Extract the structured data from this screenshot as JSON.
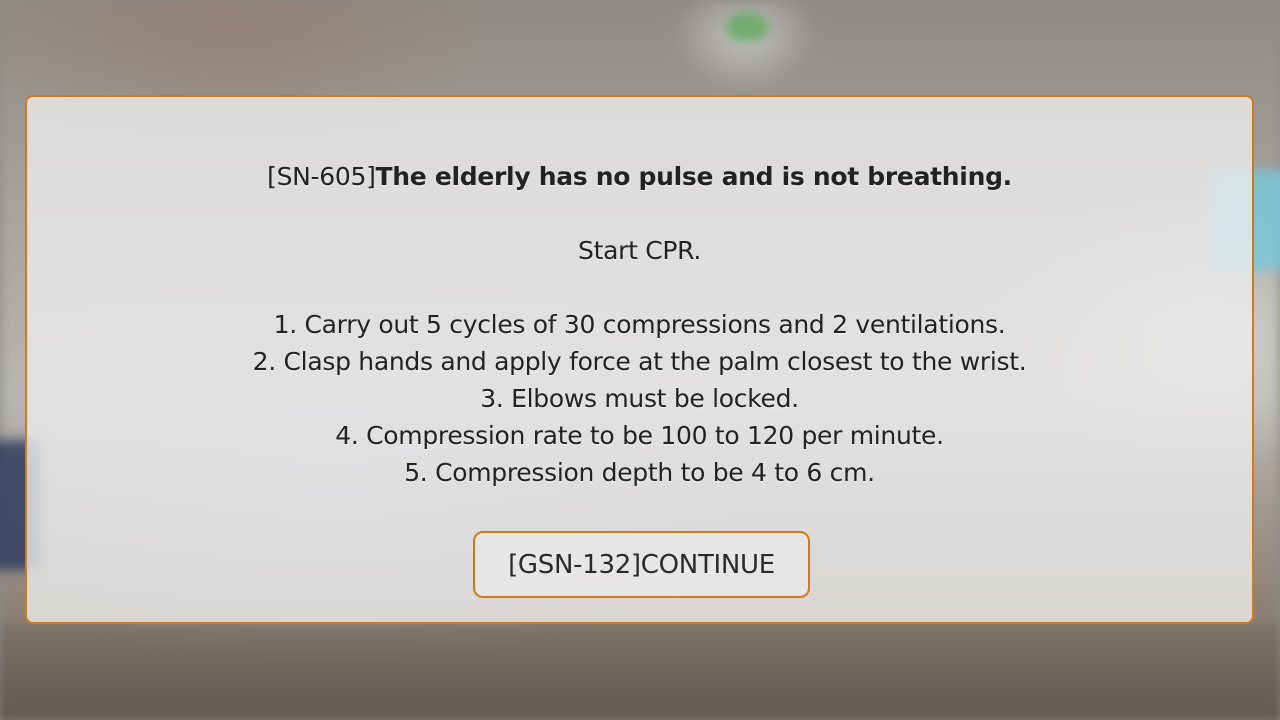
{
  "dialog": {
    "headline_code": "[SN-605]",
    "headline_text": "The elderly has no pulse and is not breathing.",
    "subheading": "Start CPR.",
    "steps": [
      "1. Carry out 5 cycles of 30 compressions and 2 ventilations.",
      "2. Clasp hands and apply force at the palm closest to the wrist.",
      "3. Elbows must be locked.",
      "4. Compression rate to be 100 to 120 per minute.",
      "5. Compression depth to be 4 to 6 cm."
    ],
    "continue_label": "[GSN-132]CONTINUE"
  },
  "colors": {
    "accent_border": "#d07a1c",
    "panel_background": "#ececec",
    "text": "#222222"
  }
}
